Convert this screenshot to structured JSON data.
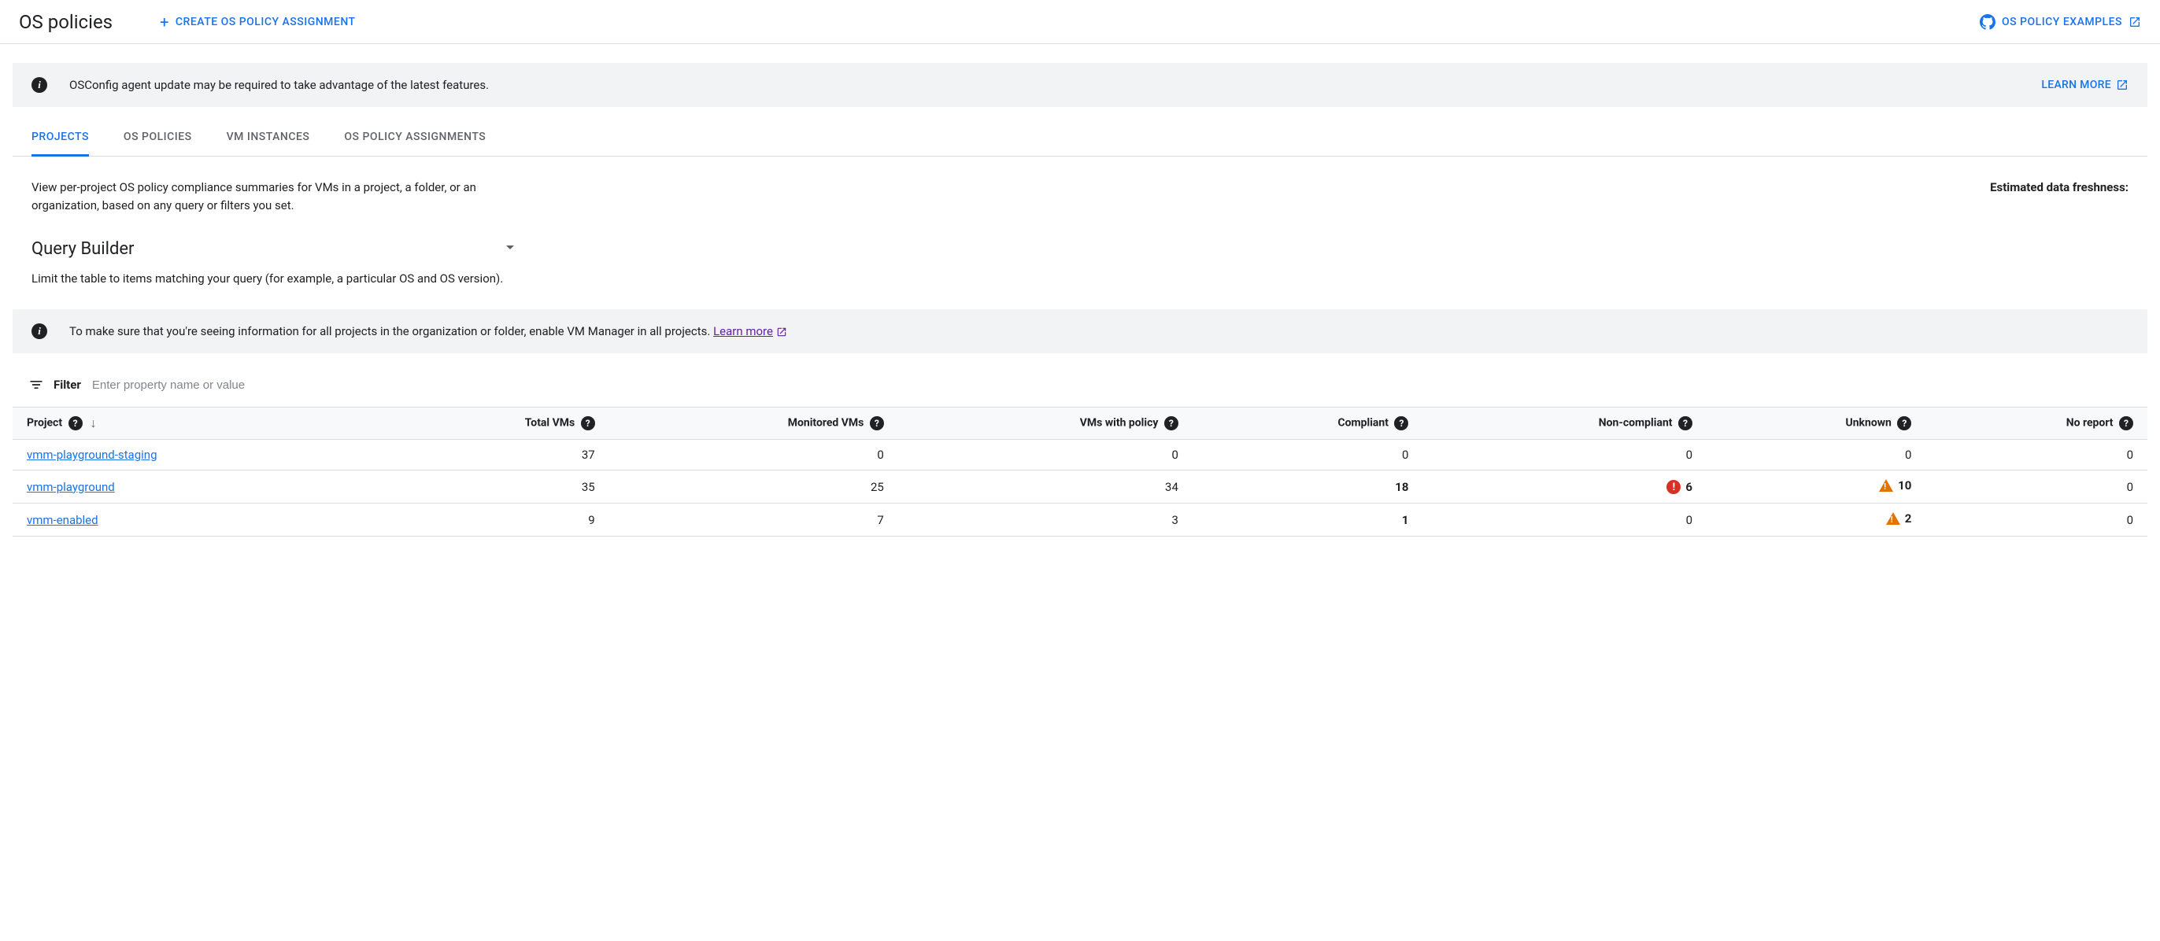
{
  "header": {
    "title": "OS policies",
    "create_label": "CREATE OS POLICY ASSIGNMENT",
    "examples_label": "OS POLICY EXAMPLES"
  },
  "banner1": {
    "text": "OSConfig agent update may be required to take advantage of the latest features.",
    "learn_more": "LEARN MORE"
  },
  "tabs": [
    {
      "label": "PROJECTS",
      "active": true
    },
    {
      "label": "OS POLICIES",
      "active": false
    },
    {
      "label": "VM INSTANCES",
      "active": false
    },
    {
      "label": "OS POLICY ASSIGNMENTS",
      "active": false
    }
  ],
  "projects_tab": {
    "description": "View per-project OS policy compliance summaries for VMs in a project, a folder, or an organization, based on any query or filters you set.",
    "freshness_label": "Estimated data freshness:"
  },
  "query_builder": {
    "title": "Query Builder",
    "description": "Limit the table to items matching your query (for example, a particular OS and OS version)."
  },
  "banner2": {
    "text_before": "To make sure that you're seeing information for all projects in the organization or folder, enable VM Manager in all projects. ",
    "link": "Learn more"
  },
  "filter": {
    "label": "Filter",
    "placeholder": "Enter property name or value"
  },
  "table": {
    "columns": [
      "Project",
      "Total VMs",
      "Monitored VMs",
      "VMs with policy",
      "Compliant",
      "Non-compliant",
      "Unknown",
      "No report"
    ],
    "rows": [
      {
        "project": "vmm-playground-staging",
        "total": 37,
        "monitored": 0,
        "policy": 0,
        "compliant": 0,
        "noncompliant": 0,
        "unknown": 0,
        "noreport": 0,
        "compliant_bold": false,
        "nc_icon": false,
        "unk_icon": false
      },
      {
        "project": "vmm-playground",
        "total": 35,
        "monitored": 25,
        "policy": 34,
        "compliant": 18,
        "noncompliant": 6,
        "unknown": 10,
        "noreport": 0,
        "compliant_bold": true,
        "nc_icon": true,
        "unk_icon": true
      },
      {
        "project": "vmm-enabled",
        "total": 9,
        "monitored": 7,
        "policy": 3,
        "compliant": 1,
        "noncompliant": 0,
        "unknown": 2,
        "noreport": 0,
        "compliant_bold": true,
        "nc_icon": false,
        "unk_icon": true
      }
    ]
  }
}
